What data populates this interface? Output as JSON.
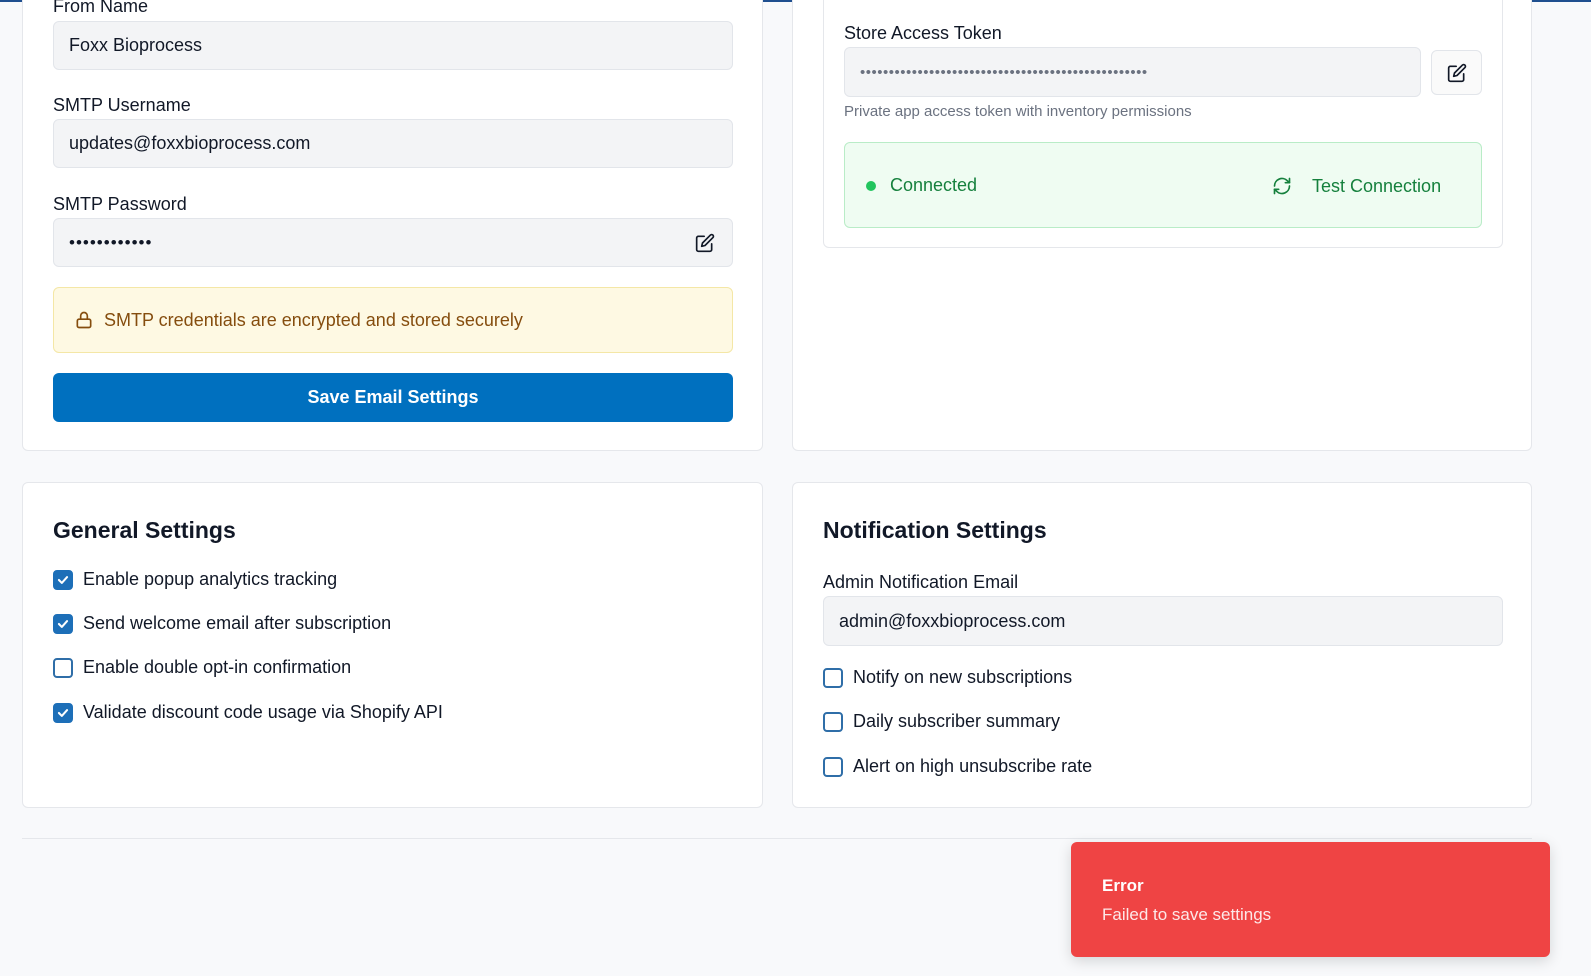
{
  "email_settings": {
    "from_name_label": "From Name",
    "from_name_value": "Foxx Bioprocess",
    "smtp_username_label": "SMTP Username",
    "smtp_username_value": "updates@foxxbioprocess.com",
    "smtp_password_label": "SMTP Password",
    "smtp_password_value": "••••••••••••",
    "secure_notice": "SMTP credentials are encrypted and stored securely",
    "save_button": "Save Email Settings"
  },
  "shopify": {
    "token_label": "Store Access Token",
    "token_value": "••••••••••••••••••••••••••••••••••••••••••••••••••",
    "token_help": "Private app access token with inventory permissions",
    "status_text": "Connected",
    "test_button": "Test Connection"
  },
  "general": {
    "title": "General Settings",
    "options": [
      {
        "label": "Enable popup analytics tracking",
        "checked": true
      },
      {
        "label": "Send welcome email after subscription",
        "checked": true
      },
      {
        "label": "Enable double opt-in confirmation",
        "checked": false
      },
      {
        "label": "Validate discount code usage via Shopify API",
        "checked": true
      }
    ]
  },
  "notifications": {
    "title": "Notification Settings",
    "admin_email_label": "Admin Notification Email",
    "admin_email_value": "admin@foxxbioprocess.com",
    "options": [
      {
        "label": "Notify on new subscriptions",
        "checked": false
      },
      {
        "label": "Daily subscriber summary",
        "checked": false
      },
      {
        "label": "Alert on high unsubscribe rate",
        "checked": false
      }
    ]
  },
  "toast": {
    "title": "Error",
    "message": "Failed to save settings"
  },
  "colors": {
    "primary": "#0070bf",
    "success_bg": "#effcf2",
    "success_text": "#15803d",
    "warning_bg": "#fef9e3",
    "warning_text": "#854d0e",
    "error_bg": "#ef4444"
  }
}
